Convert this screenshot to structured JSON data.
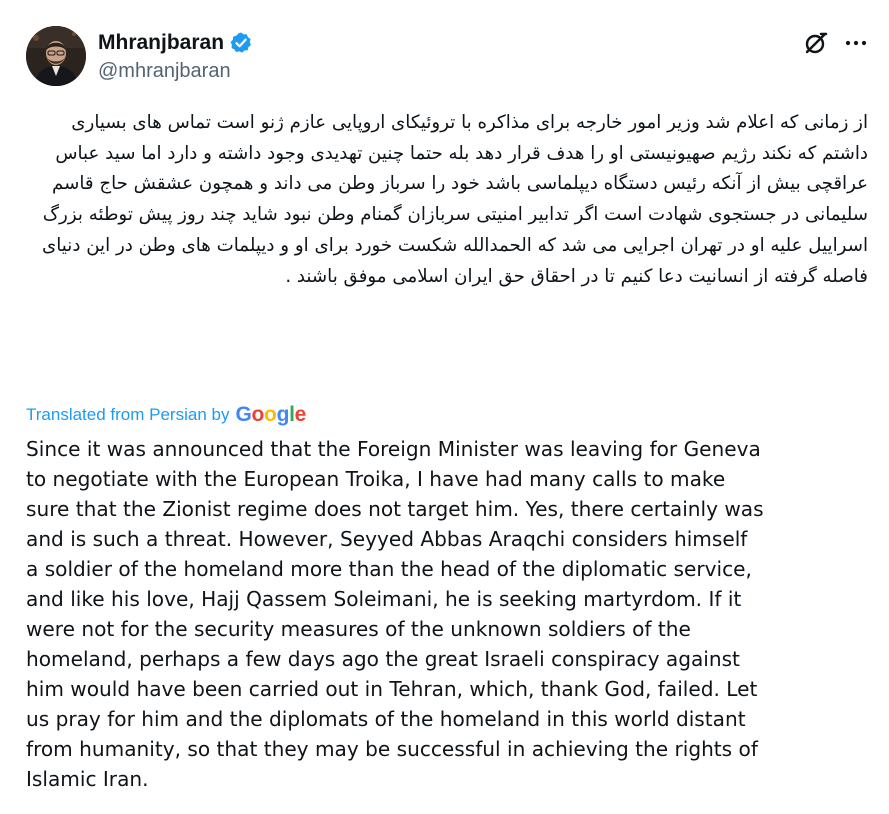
{
  "author": {
    "display_name": "Mhranjbaran",
    "handle": "@mhranjbaran",
    "verified": true
  },
  "icons": {
    "verified": "verified-badge-icon",
    "grok": "grok-icon",
    "more": "more-options-icon"
  },
  "colors": {
    "accent": "#1d9bf0",
    "text": "#0f1419",
    "secondary": "#536471"
  },
  "tweet": {
    "original_text": "از زمانی که اعلام شد وزیر امور خارجه برای مذاکره با تروئیکای اروپایی عازم ژنو است تماس های بسیاری داشتم که نکند رژیم صهیونیستی او را هدف قرار دهد بله حتما چنین تهدیدی وجود داشته و دارد اما سید عباس عراقچی بیش از آنکه رئیس دستگاه دیپلماسی باشد خود را سرباز وطن می داند و همچون عشقش حاج قاسم سلیمانی در جستجوی شهادت است اگر تدابیر امنیتی سربازان گمنام وطن نبود شاید چند روز پیش توطئه بزرگ اسراییل علیه او در تهران اجرایی می شد که الحمدالله شکست خورد برای او و دیپلمات های وطن در این دنیای  فاصله گرفته از انسانیت دعا کنیم تا در احقاق حق ایران اسلامی موفق باشند .",
    "translated_label": "Translated from Persian by",
    "translation_provider": "Google",
    "translated_lines": [
      "Since it was announced that the Foreign Minister was leaving for Geneva",
      "to negotiate with the European Troika, I have had many calls to make",
      "sure that the Zionist regime does not target him. Yes, there certainly was",
      "and is such a threat. However, Seyyed Abbas Araqchi considers himself",
      "a soldier of the homeland more than the head of the diplomatic service,",
      "and like his love, Hajj Qassem Soleimani, he is seeking martyrdom. If it",
      "were not for the security measures of the unknown soldiers of the",
      "homeland, perhaps a few days ago the great Israeli conspiracy against",
      "him would have been carried out in Tehran, which, thank God, failed. Let",
      "us pray for him and the diplomats of the homeland in this world distant",
      "from humanity, so that they may be successful in achieving the rights of",
      "Islamic Iran."
    ]
  }
}
